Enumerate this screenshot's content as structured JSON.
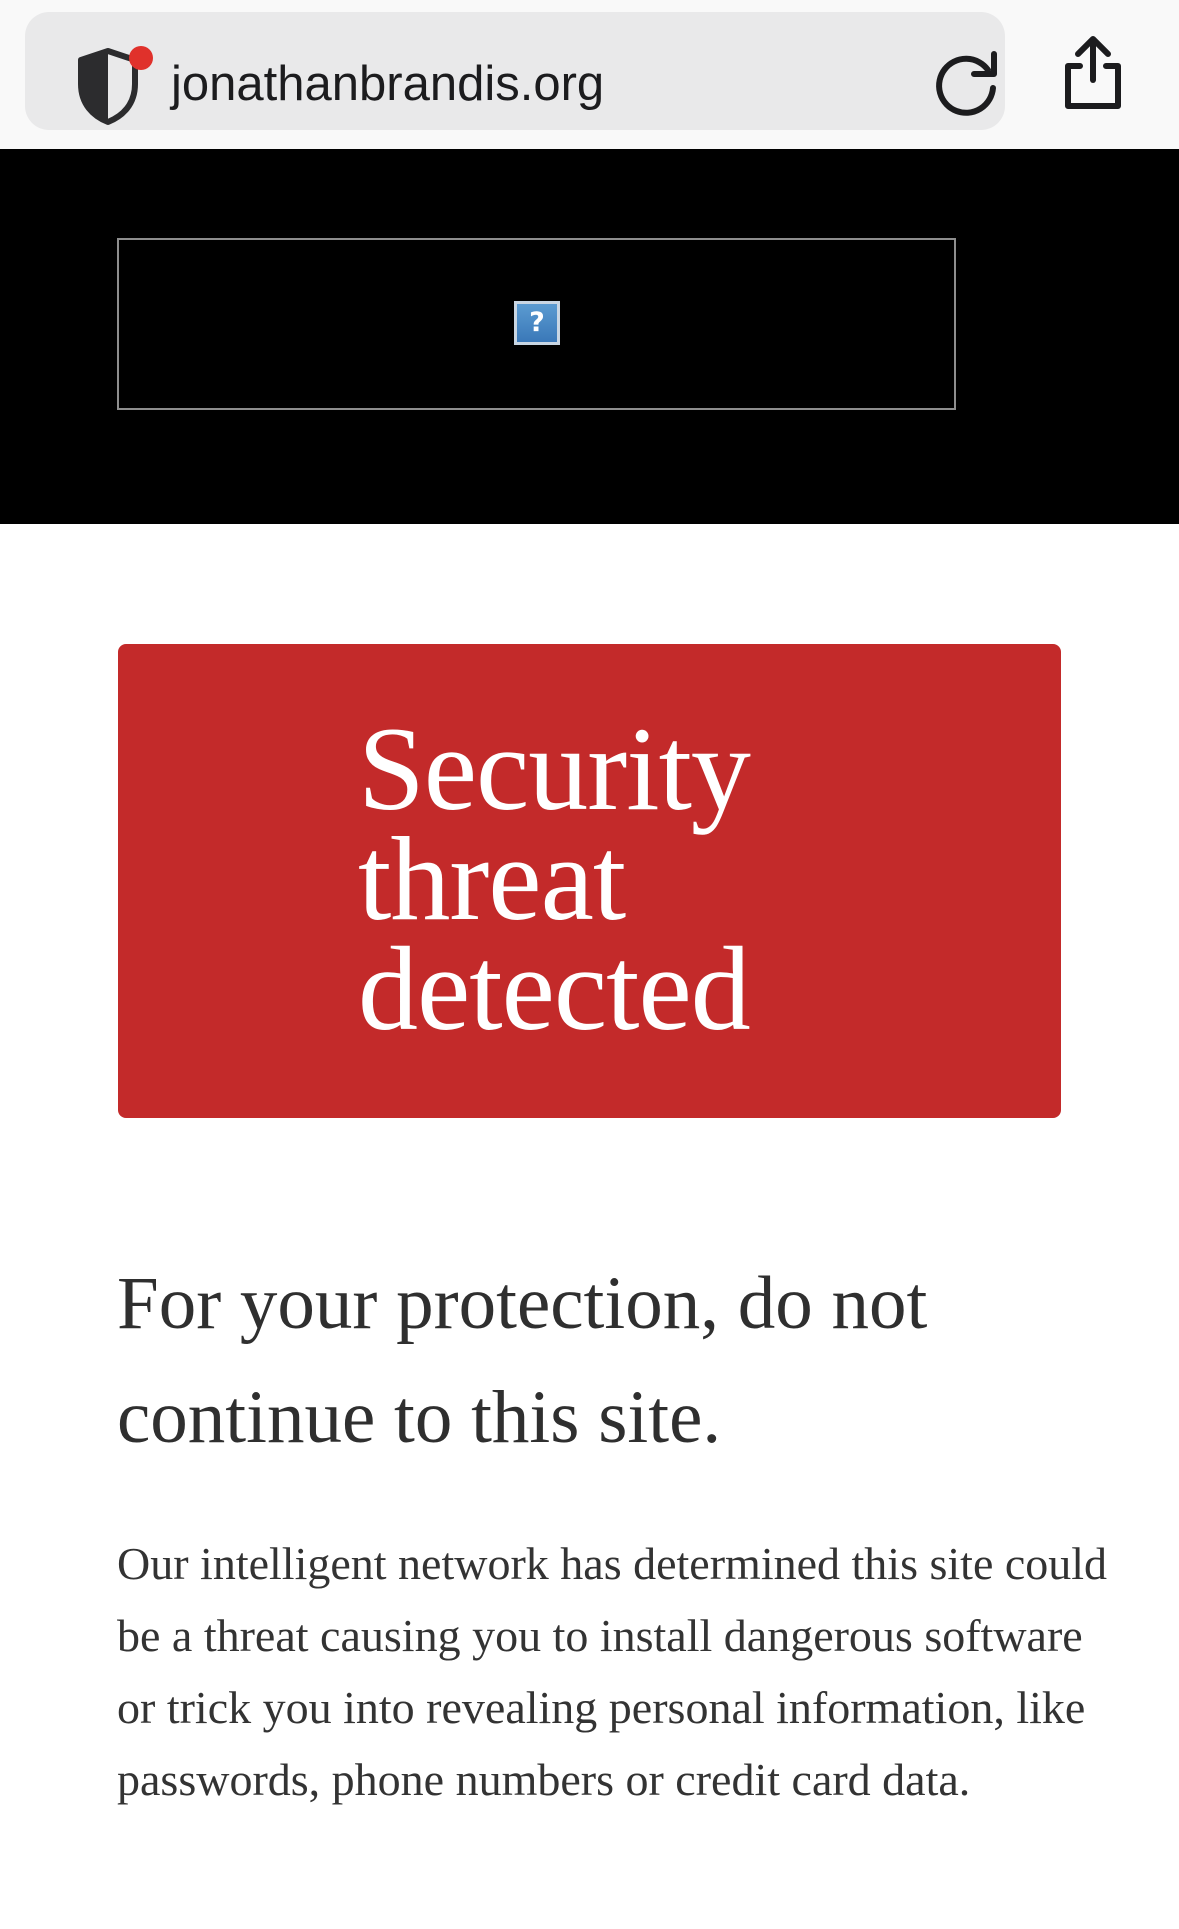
{
  "browser": {
    "url": "jonathanbrandis.org",
    "icons": {
      "site_security": "shield-icon",
      "alert_dot": "red-dot",
      "reload": "reload-icon",
      "share": "share-icon"
    },
    "alert_color": "#e0312b"
  },
  "ad": {
    "broken_image_glyph": "?"
  },
  "warning": {
    "title": "Security threat detected",
    "color": "#c32a2a"
  },
  "content": {
    "heading": "For your protection, do not continue to this site.",
    "body": "Our intelligent network has determined this site could be a threat causing you to install dangerous software or trick you into revealing personal information, like passwords, phone numbers or credit card data."
  }
}
